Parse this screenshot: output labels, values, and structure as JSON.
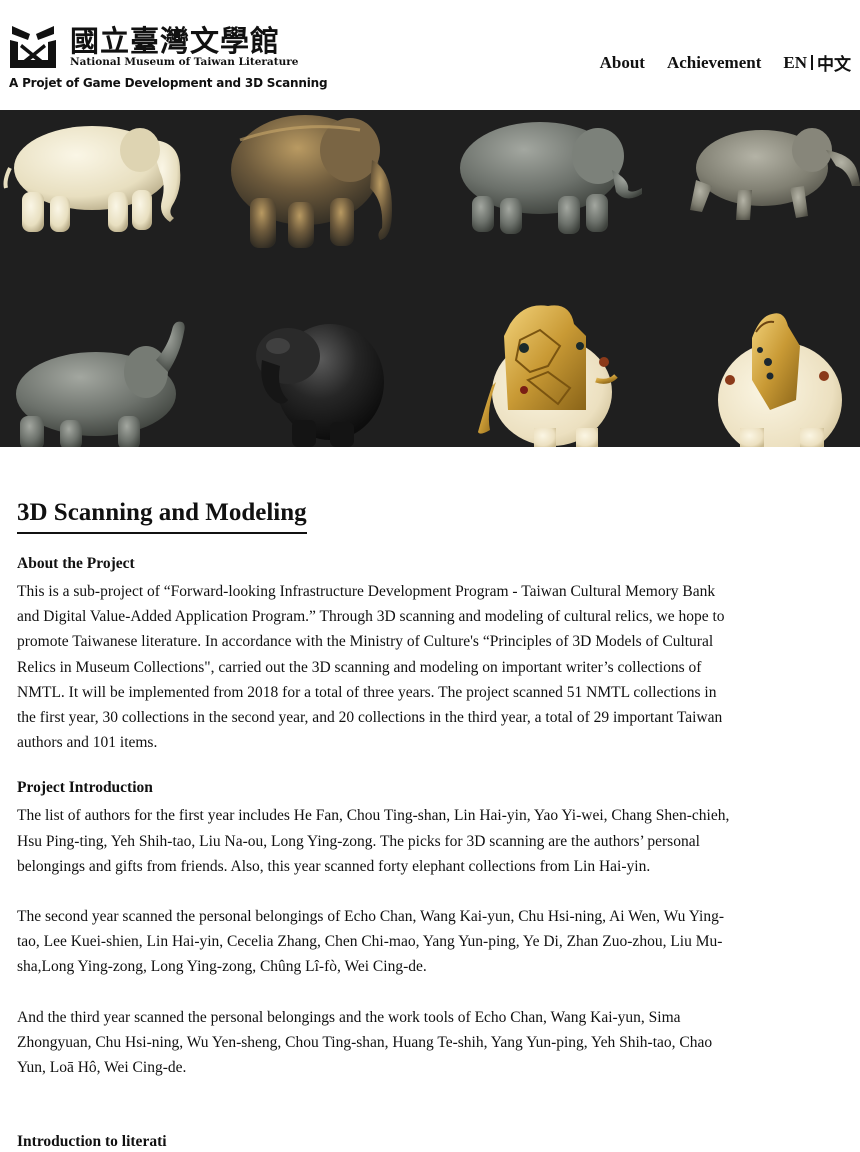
{
  "header": {
    "logo_cn": "國立臺灣文學館",
    "logo_en": "National Museum of Taiwan Literature",
    "logo_subtitle": "A Projet of Game Development and 3D Scanning"
  },
  "nav": {
    "about": "About",
    "achievement": "Achievement",
    "lang_en": "EN",
    "lang_zh": "中文"
  },
  "banner": {
    "background_color": "#1f1f1f",
    "items": [
      "white-elephant",
      "bronze-elephant",
      "grey-glass-elephant",
      "grey-walking-elephant",
      "grey-trumpeting-elephant",
      "black-elephant",
      "gold-saddle-elephant",
      "jeweled-ivory-elephant"
    ]
  },
  "main": {
    "title": "3D Scanning and Modeling",
    "about_heading": "About the Project",
    "about_text": "This is a sub-project of “Forward-looking Infrastructure Development Program - Taiwan Cultural Memory Bank and Digital Value-Added Application Program.” Through 3D scanning and modeling of cultural relics, we hope to promote Taiwanese literature. In accordance with the Ministry of Culture's “Principles of 3D Models of Cultural Relics in Museum Collections\", carried out the 3D scanning and modeling on important writer’s collections of NMTL. It will be implemented from 2018 for a total of three years. The project scanned 51 NMTL collections in the first year, 30 collections in the second year, and 20 collections in the third year, a total of 29 important Taiwan authors and 101 items.",
    "intro_heading": "Project Introduction",
    "intro_p1": "The list of authors for the first year includes He Fan, Chou Ting-shan, Lin Hai-yin, Yao Yi-wei, Chang Shen-chieh, Hsu Ping-ting, Yeh Shih-tao, Liu Na-ou, Long Ying-zong. The picks for 3D scanning are the authors’ personal belongings and gifts from friends. Also, this year scanned forty elephant collections from Lin Hai-yin.",
    "intro_p2": "The second year scanned the personal belongings of Echo Chan, Wang Kai-yun, Chu Hsi-ning, Ai Wen, Wu Ying-tao, Lee Kuei-shien, Lin Hai-yin, Cecelia Zhang, Chen Chi-mao, Yang Yun-ping, Ye Di, Zhan Zuo-zhou, Liu Mu-sha,Long Ying-zong, Long Ying-zong, Chûng Lî-fò, Wei Cing-de.",
    "intro_p3": "And the third year scanned the personal belongings and the work tools of Echo Chan, Wang Kai-yun, Sima Zhongyuan, Chu Hsi-ning, Wu Yen-sheng, Chou Ting-shan, Huang Te-shih, Yang Yun-ping, Yeh Shih-tao, Chao Yun, Loā Hô, Wei Cing-de.",
    "next_heading": "Introduction to literati"
  }
}
